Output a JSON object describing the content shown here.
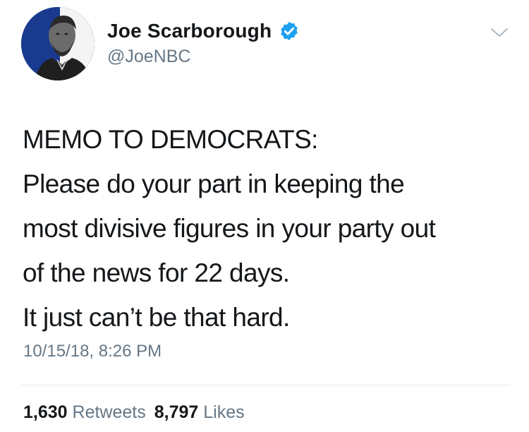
{
  "author": {
    "name": "Joe Scarborough",
    "handle": "@JoeNBC",
    "verified": true,
    "avatar_icon": "lincoln-portrait-avatar"
  },
  "tweet": {
    "lines": [
      "MEMO TO DEMOCRATS:",
      "Please do your part in keeping the",
      "most divisive figures in your party out",
      "of the news for 22 days.",
      "It just can’t be that hard."
    ],
    "timestamp": "10/15/18, 8:26 PM"
  },
  "stats": {
    "retweets_count": "1,630",
    "retweets_label": "Retweets",
    "likes_count": "8,797",
    "likes_label": "Likes"
  },
  "icons": {
    "verified": "verified-badge-icon",
    "menu": "chevron-down-icon"
  },
  "colors": {
    "text": "#14171a",
    "secondary": "#657786",
    "verified": "#1da1f2",
    "divider": "#e1e8ed"
  }
}
